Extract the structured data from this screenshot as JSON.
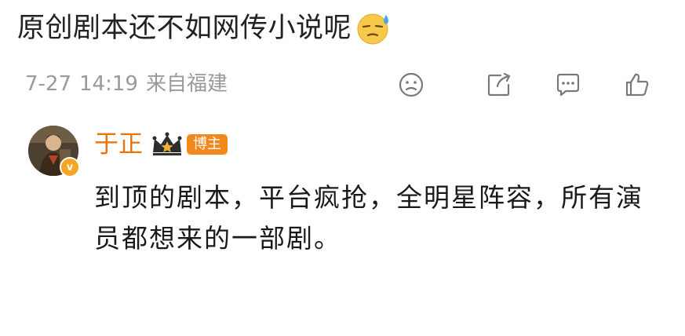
{
  "comment": {
    "text": "原创剧本还不如网传小说呢",
    "emoji": "sweat-smile-emoji"
  },
  "meta": {
    "date": "7-27",
    "time": "14:19",
    "location": "来自福建"
  },
  "actions": {
    "icons": [
      "smile-react-icon",
      "share-icon",
      "comment-icon",
      "like-icon"
    ]
  },
  "reply": {
    "username": "于正",
    "badge": "博主",
    "text": "到顶的剧本，平台疯抢，全明星阵容，所有演员都想来的一部剧。",
    "verified_color": "#f5a623",
    "name_color": "#e8740c"
  }
}
